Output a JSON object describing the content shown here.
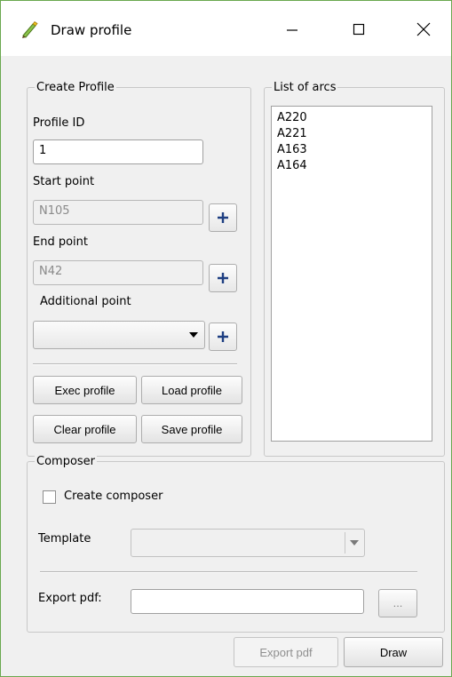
{
  "window": {
    "title": "Draw profile"
  },
  "create_profile": {
    "legend": "Create Profile",
    "profile_id_label": "Profile ID",
    "profile_id_value": "1",
    "start_point_label": "Start point",
    "start_point_value": "N105",
    "end_point_label": "End point",
    "end_point_value": "N42",
    "additional_point_label": "Additional point",
    "additional_point_value": "",
    "exec_profile": "Exec profile",
    "load_profile": "Load profile",
    "clear_profile": "Clear profile",
    "save_profile": "Save profile"
  },
  "list_of_arcs": {
    "legend": "List of arcs",
    "items": [
      "A220",
      "A221",
      "A163",
      "A164"
    ]
  },
  "composer": {
    "legend": "Composer",
    "create_composer_label": "Create composer",
    "create_composer_checked": false,
    "template_label": "Template",
    "template_value": "",
    "export_pdf_label": "Export pdf:",
    "export_pdf_path": "",
    "browse_label": "..."
  },
  "footer": {
    "export_pdf": "Export pdf",
    "draw": "Draw"
  },
  "icons": {
    "app": "qgis-pencil-icon",
    "minimize": "minimize-icon",
    "maximize": "maximize-icon",
    "close": "close-icon",
    "add": "plus-icon",
    "dropdown": "chevron-down-icon"
  }
}
